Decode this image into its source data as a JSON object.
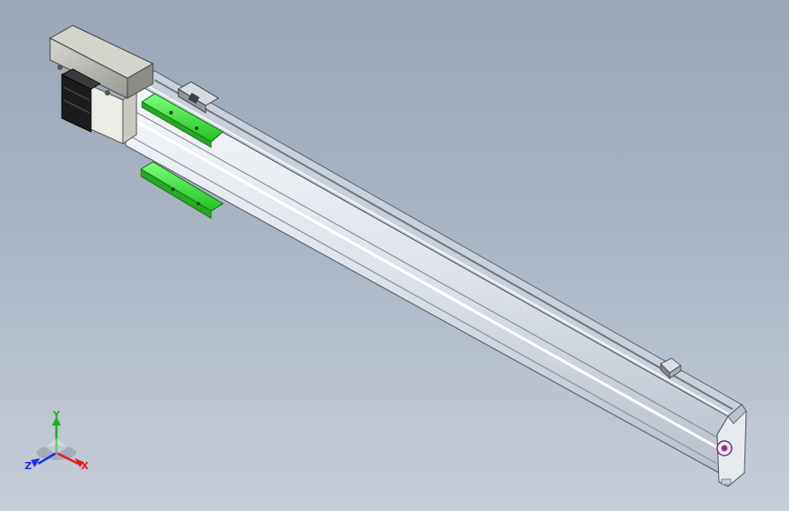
{
  "viewport": {
    "background_top": "#9ba7b7",
    "background_bottom": "#c6ced8"
  },
  "model": {
    "description_icon": "linear-actuator-model",
    "highlight_color": "#34e534",
    "body_color": "#e4e8ee"
  },
  "triad": {
    "x_label": "X",
    "y_label": "Y",
    "z_label": "Z",
    "x_color": "#e02020",
    "y_color": "#20b020",
    "z_color": "#2030e0"
  }
}
